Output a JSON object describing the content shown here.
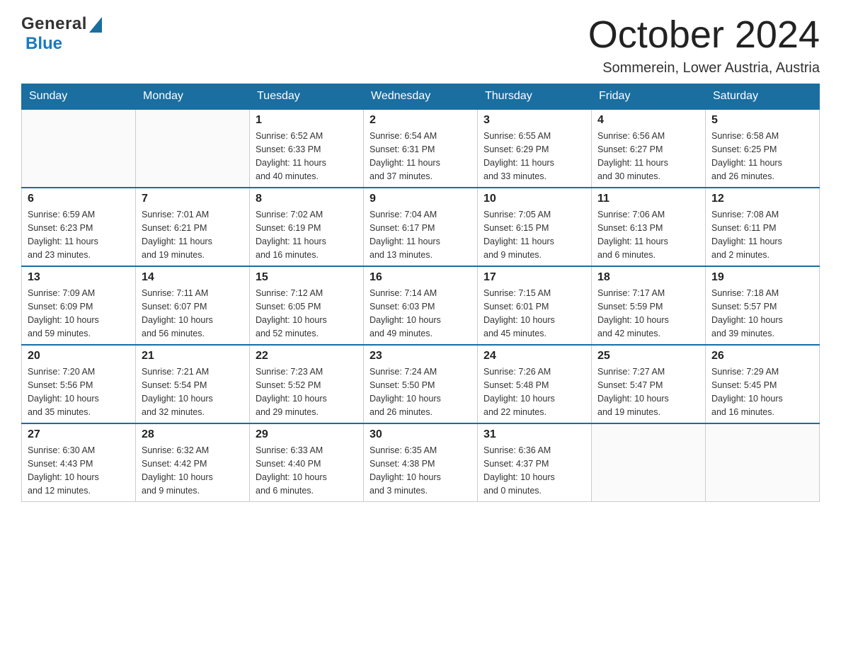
{
  "logo": {
    "general": "General",
    "blue": "Blue"
  },
  "header": {
    "month": "October 2024",
    "location": "Sommerein, Lower Austria, Austria"
  },
  "days_of_week": [
    "Sunday",
    "Monday",
    "Tuesday",
    "Wednesday",
    "Thursday",
    "Friday",
    "Saturday"
  ],
  "weeks": [
    [
      {
        "day": "",
        "info": ""
      },
      {
        "day": "",
        "info": ""
      },
      {
        "day": "1",
        "info": "Sunrise: 6:52 AM\nSunset: 6:33 PM\nDaylight: 11 hours\nand 40 minutes."
      },
      {
        "day": "2",
        "info": "Sunrise: 6:54 AM\nSunset: 6:31 PM\nDaylight: 11 hours\nand 37 minutes."
      },
      {
        "day": "3",
        "info": "Sunrise: 6:55 AM\nSunset: 6:29 PM\nDaylight: 11 hours\nand 33 minutes."
      },
      {
        "day": "4",
        "info": "Sunrise: 6:56 AM\nSunset: 6:27 PM\nDaylight: 11 hours\nand 30 minutes."
      },
      {
        "day": "5",
        "info": "Sunrise: 6:58 AM\nSunset: 6:25 PM\nDaylight: 11 hours\nand 26 minutes."
      }
    ],
    [
      {
        "day": "6",
        "info": "Sunrise: 6:59 AM\nSunset: 6:23 PM\nDaylight: 11 hours\nand 23 minutes."
      },
      {
        "day": "7",
        "info": "Sunrise: 7:01 AM\nSunset: 6:21 PM\nDaylight: 11 hours\nand 19 minutes."
      },
      {
        "day": "8",
        "info": "Sunrise: 7:02 AM\nSunset: 6:19 PM\nDaylight: 11 hours\nand 16 minutes."
      },
      {
        "day": "9",
        "info": "Sunrise: 7:04 AM\nSunset: 6:17 PM\nDaylight: 11 hours\nand 13 minutes."
      },
      {
        "day": "10",
        "info": "Sunrise: 7:05 AM\nSunset: 6:15 PM\nDaylight: 11 hours\nand 9 minutes."
      },
      {
        "day": "11",
        "info": "Sunrise: 7:06 AM\nSunset: 6:13 PM\nDaylight: 11 hours\nand 6 minutes."
      },
      {
        "day": "12",
        "info": "Sunrise: 7:08 AM\nSunset: 6:11 PM\nDaylight: 11 hours\nand 2 minutes."
      }
    ],
    [
      {
        "day": "13",
        "info": "Sunrise: 7:09 AM\nSunset: 6:09 PM\nDaylight: 10 hours\nand 59 minutes."
      },
      {
        "day": "14",
        "info": "Sunrise: 7:11 AM\nSunset: 6:07 PM\nDaylight: 10 hours\nand 56 minutes."
      },
      {
        "day": "15",
        "info": "Sunrise: 7:12 AM\nSunset: 6:05 PM\nDaylight: 10 hours\nand 52 minutes."
      },
      {
        "day": "16",
        "info": "Sunrise: 7:14 AM\nSunset: 6:03 PM\nDaylight: 10 hours\nand 49 minutes."
      },
      {
        "day": "17",
        "info": "Sunrise: 7:15 AM\nSunset: 6:01 PM\nDaylight: 10 hours\nand 45 minutes."
      },
      {
        "day": "18",
        "info": "Sunrise: 7:17 AM\nSunset: 5:59 PM\nDaylight: 10 hours\nand 42 minutes."
      },
      {
        "day": "19",
        "info": "Sunrise: 7:18 AM\nSunset: 5:57 PM\nDaylight: 10 hours\nand 39 minutes."
      }
    ],
    [
      {
        "day": "20",
        "info": "Sunrise: 7:20 AM\nSunset: 5:56 PM\nDaylight: 10 hours\nand 35 minutes."
      },
      {
        "day": "21",
        "info": "Sunrise: 7:21 AM\nSunset: 5:54 PM\nDaylight: 10 hours\nand 32 minutes."
      },
      {
        "day": "22",
        "info": "Sunrise: 7:23 AM\nSunset: 5:52 PM\nDaylight: 10 hours\nand 29 minutes."
      },
      {
        "day": "23",
        "info": "Sunrise: 7:24 AM\nSunset: 5:50 PM\nDaylight: 10 hours\nand 26 minutes."
      },
      {
        "day": "24",
        "info": "Sunrise: 7:26 AM\nSunset: 5:48 PM\nDaylight: 10 hours\nand 22 minutes."
      },
      {
        "day": "25",
        "info": "Sunrise: 7:27 AM\nSunset: 5:47 PM\nDaylight: 10 hours\nand 19 minutes."
      },
      {
        "day": "26",
        "info": "Sunrise: 7:29 AM\nSunset: 5:45 PM\nDaylight: 10 hours\nand 16 minutes."
      }
    ],
    [
      {
        "day": "27",
        "info": "Sunrise: 6:30 AM\nSunset: 4:43 PM\nDaylight: 10 hours\nand 12 minutes."
      },
      {
        "day": "28",
        "info": "Sunrise: 6:32 AM\nSunset: 4:42 PM\nDaylight: 10 hours\nand 9 minutes."
      },
      {
        "day": "29",
        "info": "Sunrise: 6:33 AM\nSunset: 4:40 PM\nDaylight: 10 hours\nand 6 minutes."
      },
      {
        "day": "30",
        "info": "Sunrise: 6:35 AM\nSunset: 4:38 PM\nDaylight: 10 hours\nand 3 minutes."
      },
      {
        "day": "31",
        "info": "Sunrise: 6:36 AM\nSunset: 4:37 PM\nDaylight: 10 hours\nand 0 minutes."
      },
      {
        "day": "",
        "info": ""
      },
      {
        "day": "",
        "info": ""
      }
    ]
  ]
}
